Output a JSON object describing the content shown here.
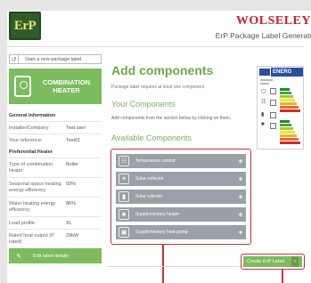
{
  "header": {
    "logo_text": "ErP",
    "brand": "WOLSELEY",
    "subtitle": "ErP Package Label Generator"
  },
  "sidebar": {
    "start_label": "Start a new package label",
    "heater_title": "COMBINATION HEATER",
    "general_title": "General information",
    "general_rows": [
      {
        "k": "Installer/Company:",
        "v": "Test user"
      },
      {
        "k": "Your reference:",
        "v": "Test01"
      }
    ],
    "heater_section_title": "Preferential Heater",
    "heater_rows": [
      {
        "k": "Type of combination heater:",
        "v": "Boiler"
      },
      {
        "k": "Seasonal space heating energy efficiency:",
        "v": "93%"
      },
      {
        "k": "Water heating energy efficiency:",
        "v": "86%"
      },
      {
        "k": "Load profile:",
        "v": "XL"
      },
      {
        "k": "Rated heat output (P rated):",
        "v": "29kW"
      }
    ],
    "edit_label": "Edit label details"
  },
  "main": {
    "title": "Add components",
    "requirement_note": "Package label requires at least one component",
    "your_title": "Your Components",
    "add_note": "Add components from the section below by clicking on them.",
    "available_title": "Available Components",
    "components": [
      {
        "label": "Temperature control",
        "icon": "thermostat-icon"
      },
      {
        "label": "Solar collector",
        "icon": "solar-collector-icon"
      },
      {
        "label": "Solar cylinder",
        "icon": "cylinder-icon"
      },
      {
        "label": "Supplementary heater",
        "icon": "heater-icon"
      },
      {
        "label": "Supplementary heat pump",
        "icon": "heat-pump-icon"
      }
    ],
    "create_label": "Create ErP Label",
    "create_arrow": "›"
  },
  "energy_label": {
    "word": "ENERG"
  },
  "colors": {
    "accent_green": "#7cbb5e",
    "title_green": "#6aaa4b",
    "callout_red": "#c8323c",
    "component_grey": "#9aa0a8",
    "brand_red": "#c8202c"
  }
}
